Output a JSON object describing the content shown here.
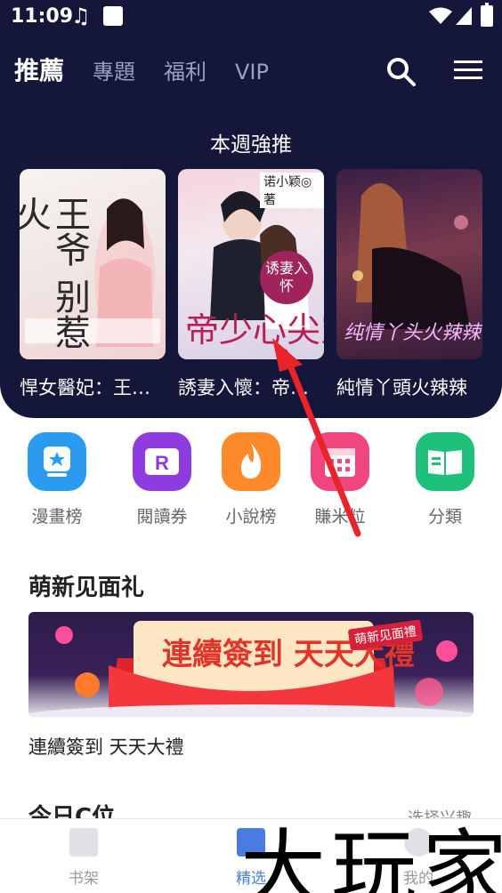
{
  "status": {
    "time": "11:09"
  },
  "header": {
    "tabs": [
      {
        "label": "推薦"
      },
      {
        "label": "專題"
      },
      {
        "label": "福利"
      },
      {
        "label": "VIP"
      }
    ]
  },
  "featured": {
    "title": "本週強推",
    "books": [
      {
        "title": "悍女醫妃：王…",
        "cover_text": "王爷 别惹火"
      },
      {
        "title": "誘妻入懷：帝…",
        "cover_text": "帝少心尖宠",
        "cover_author": "诺小颖◎著",
        "cover_badge": "诱妻入怀"
      },
      {
        "title": "純情丫頭火辣辣",
        "cover_text": "纯情丫头火辣辣"
      }
    ]
  },
  "entries": [
    {
      "label": "漫畫榜",
      "color": "#2b9bf0"
    },
    {
      "label": "閱讀券",
      "color": "#8e3be0"
    },
    {
      "label": "小說榜",
      "color": "#ff8a2b"
    },
    {
      "label": "賺米粒",
      "color": "#f0457d"
    },
    {
      "label": "分類",
      "color": "#1fc07a"
    }
  ],
  "welcome": {
    "title": "萌新见面礼",
    "banner_main": "連續簽到 天天大禮",
    "banner_tag": "萌新见面禮",
    "caption": "連續簽到 天天大禮"
  },
  "next_section": {
    "title": "今日C位",
    "more": "选择兴趣"
  },
  "bottom_nav": [
    {
      "label": "书架"
    },
    {
      "label": "精选"
    },
    {
      "label": "我的"
    }
  ],
  "watermark": "大玩家"
}
